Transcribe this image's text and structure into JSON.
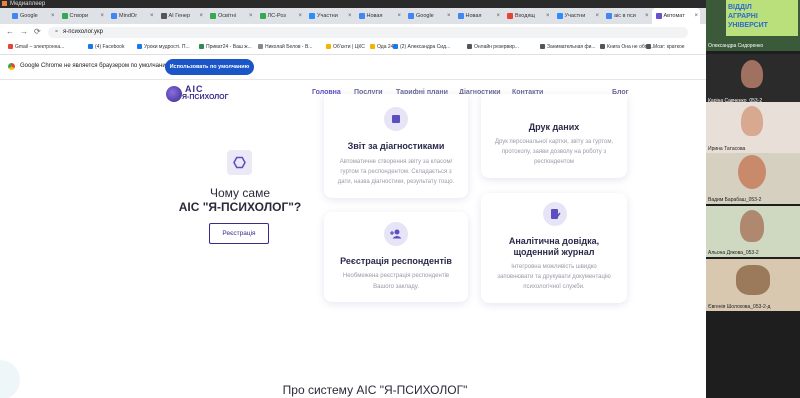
{
  "media_player": {
    "title": "Медиаплеер"
  },
  "tabs": [
    {
      "label": "Google",
      "color": "#4285f4"
    },
    {
      "label": "Створи",
      "color": "#34a853"
    },
    {
      "label": "MindOr",
      "color": "#4285f4"
    },
    {
      "label": "AI Генер",
      "color": "#555555"
    },
    {
      "label": "Освітні",
      "color": "#34a853"
    },
    {
      "label": "ЛС-Роз",
      "color": "#34a853"
    },
    {
      "label": "Участни",
      "color": "#2d8cff"
    },
    {
      "label": "Новая",
      "color": "#4285f4"
    },
    {
      "label": "Google",
      "color": "#4285f4"
    },
    {
      "label": "Новая",
      "color": "#4285f4"
    },
    {
      "label": "Входящ",
      "color": "#ea4335"
    },
    {
      "label": "Участни",
      "color": "#2d8cff"
    },
    {
      "label": "aic в пси",
      "color": "#4285f4"
    },
    {
      "label": "Автомат",
      "color": "#6a4fcf"
    }
  ],
  "address": {
    "url": "я-психолог.укр"
  },
  "bookmarks": [
    "Gmail – электронна...",
    "(4) Facebook",
    "Уроки мудрості. П...",
    "Приват24 - Ваш ж...",
    "Николай Белов - В...",
    "Об'єкти | ЦКС",
    "Ода 24",
    "(2) Александра Сид...",
    "Онлайн резервир...",
    "Занимательная фи...",
    "Книга Она не объя...",
    "Мозг: краткое"
  ],
  "infobar": {
    "message": "Google Chrome не является браузером по умолчанию.",
    "button": "Использовать по умолчанию"
  },
  "site": {
    "logo_top": "AIC",
    "logo_bottom": "Я-ПСИХОЛОГ",
    "nav": [
      "Головна",
      "Послуги",
      "Тарифні плани",
      "Діагностики",
      "Контакти"
    ],
    "nav_right": "Блог",
    "hero_title_line1": "Чому саме",
    "hero_title_line2": "АІС \"Я-ПСИХОЛОГ\"?",
    "hero_button": "Реєстрація",
    "cards": [
      {
        "title": "Звіт за діагностиками",
        "text": [
          "Автоматичне створення звіту за класом/",
          "гуртом та респондентом. Складається з",
          "дати, назва діагностики, результату тощо."
        ]
      },
      {
        "title": "Друк даних",
        "text": [
          "Друк персональної картки, звіту за гуртом,",
          "протоколу, заяви дозволу на роботу з",
          "респондентом"
        ]
      },
      {
        "title": "Реєстрація респондентів",
        "text": [
          "Необмежена реєстрація респондентів",
          "Вашого закладу."
        ]
      },
      {
        "title_lines": [
          "Аналітична довідка,",
          "щоденний журнал"
        ],
        "text": [
          "Інтегровна можливість швидко",
          "заповнювати та друкувати документацію",
          "психологічної служби."
        ]
      }
    ],
    "section_title": "Про систему АІС \"Я-ПСИХОЛОГ\""
  },
  "participants": [
    {
      "name": "Олександра Сидоренко",
      "banner": [
        "ВІДДІЛ",
        "АГРАРНІ",
        "УНІВЕРСИТ"
      ]
    },
    {
      "name": "Каріна Савченко_053-2"
    },
    {
      "name": "Ирина Татасова"
    },
    {
      "name": "Вадим Барабаш_053-2"
    },
    {
      "name": "Альона Дякова_053-2"
    },
    {
      "name": "Євгенія Шолохова_053-2-д"
    }
  ]
}
